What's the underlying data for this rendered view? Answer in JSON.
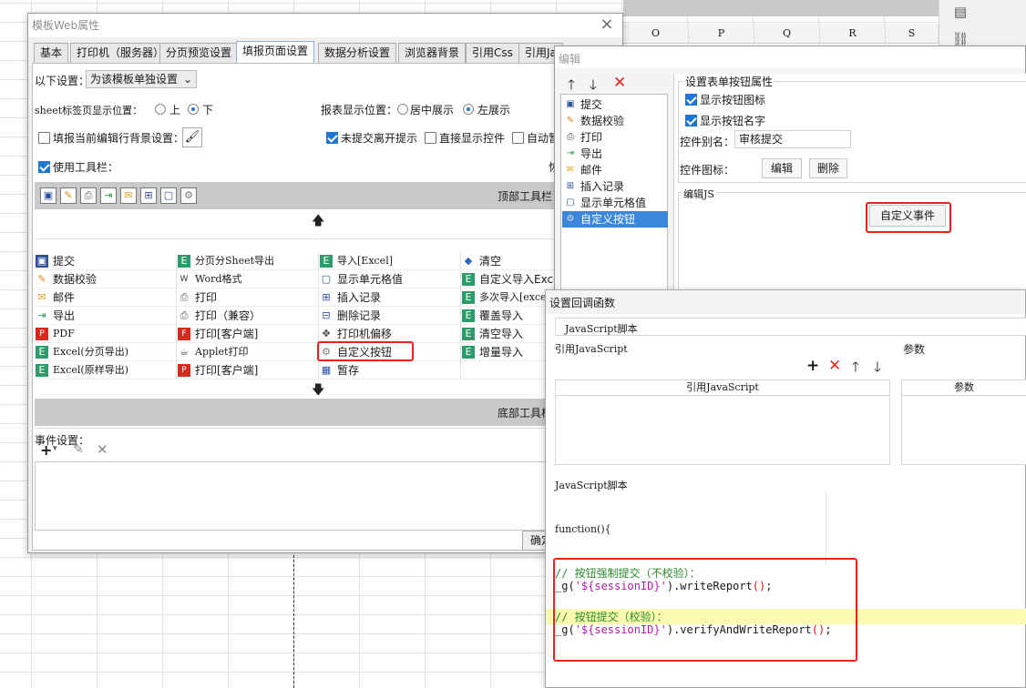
{
  "spreadsheet": {
    "columns": [
      "O",
      "P",
      "Q",
      "R",
      "S"
    ]
  },
  "main_dialog": {
    "title": "模板Web属性",
    "close_icon": "×",
    "tabs": [
      "基本",
      "打印机（服务器）",
      "分页预览设置",
      "填报页面设置",
      "数据分析设置",
      "浏览器背景",
      "引用Css",
      "引用Ja"
    ],
    "active_tab": "填报页面设置",
    "settings_label": "以下设置：",
    "settings_select": "为该模板单独设置",
    "sheet_tab_label": "sheet标签页显示位置：",
    "sheet_tab_options": [
      "上",
      "下"
    ],
    "sheet_tab_selected": "下",
    "report_display_label": "报表显示位置：",
    "report_display_options": [
      "居中展示",
      "左展示"
    ],
    "report_display_selected": "左展示",
    "fill_bg_label": "填报当前编辑行背景设置：",
    "unsubmitted_label": "未提交离开提示",
    "direct_show_label": "直接显示控件",
    "auto_label": "自动暂",
    "use_toolbar_label": "使用工具栏：",
    "partial_button": "恢",
    "top_toolbar_label": "顶部工具栏",
    "bottom_toolbar_label": "底部工具栏",
    "grid": [
      [
        "提交",
        "分页分Sheet导出",
        "导入[Excel]",
        "清空"
      ],
      [
        "数据校验",
        "Word格式",
        "显示单元格值",
        "自定义导入Excel行"
      ],
      [
        "邮件",
        "打印",
        "插入记录",
        "多次导入[excel]"
      ],
      [
        "导出",
        "打印（兼容）",
        "删除记录",
        "覆盖导入"
      ],
      [
        "PDF",
        "打印[客户端]",
        "打印机偏移",
        "清空导入"
      ],
      [
        "Excel(分页导出)",
        "Applet打印",
        "自定义按钮",
        "增量导入"
      ],
      [
        "Excel(原样导出)",
        "打印[客户端]",
        "暂存",
        ""
      ]
    ],
    "event_settings_label": "事件设置：",
    "confirm_button": "确定"
  },
  "edit_dialog": {
    "title": "编辑",
    "list_items": [
      "提交",
      "数据校验",
      "打印",
      "导出",
      "邮件",
      "插入记录",
      "显示单元格值",
      "自定义按钮"
    ],
    "selected_item": "自定义按钮",
    "props_title": "设置表单按钮属性",
    "show_icon_label": "显示按钮图标",
    "show_name_label": "显示按钮名字",
    "alias_label": "控件别名：",
    "alias_value": "审核提交",
    "icon_label": "控件图标：",
    "edit_button": "编辑",
    "delete_button": "删除",
    "edit_js_label": "编辑JS",
    "custom_event_button": "自定义事件"
  },
  "callback_dialog": {
    "title": "设置回调函数",
    "js_tab": "JavaScript脚本",
    "ref_js_label": "引用JavaScript",
    "params_label": "参数",
    "ref_js_col": "引用JavaScript",
    "params_col": "参数",
    "script_label": "JavaScript脚本",
    "function_header": "function(){",
    "code": {
      "comment1": "// 按钮强制提交（不校验）：",
      "line1_prefix": "_g(",
      "line1_str": "'${sessionID}'",
      "line1_suffix": ").writeReport",
      "line1_paren": "()",
      "line1_end": ";",
      "comment2": "// 按钮提交（校验）：",
      "line2_prefix": "_g(",
      "line2_str": "'${sessionID}'",
      "line2_suffix": ").verifyAndWriteReport",
      "line2_paren": "()",
      "line2_end": ";"
    }
  },
  "colors": {
    "highlight_red": "#e8241a",
    "selection_blue": "#3b87db",
    "comment_green": "#2a8a2a",
    "string_purple": "#b01ea8"
  }
}
